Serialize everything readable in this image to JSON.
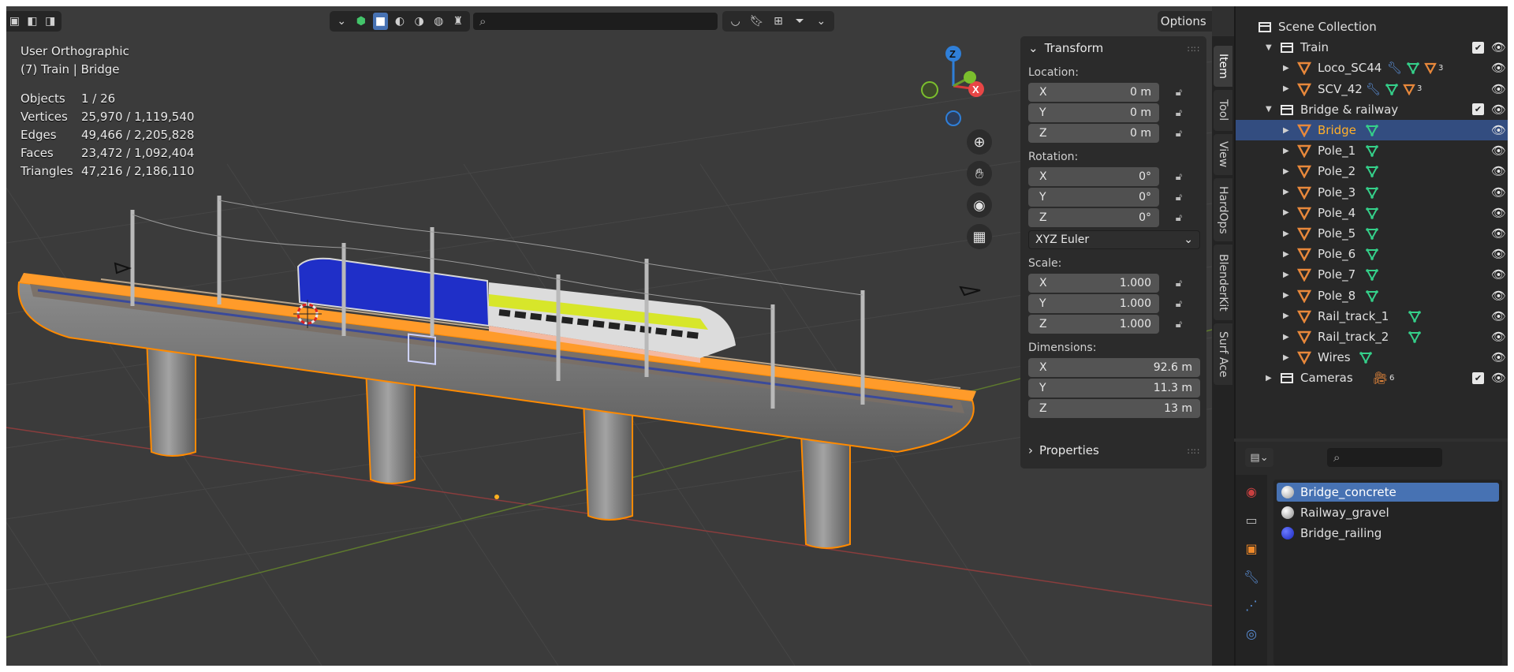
{
  "viewport": {
    "view_name": "User Orthographic",
    "active_object": "(7) Train | Bridge",
    "stats": [
      {
        "label": "Objects",
        "value": "1 / 26"
      },
      {
        "label": "Vertices",
        "value": "25,970 / 1,119,540"
      },
      {
        "label": "Edges",
        "value": "49,466 / 2,205,828"
      },
      {
        "label": "Faces",
        "value": "23,472 / 1,092,404"
      },
      {
        "label": "Triangles",
        "value": "47,216 / 2,186,110"
      }
    ],
    "options_label": "Options",
    "gizmo": {
      "z": "Z",
      "x": "X"
    }
  },
  "npanel": {
    "transform_title": "Transform",
    "location_label": "Location:",
    "location": [
      {
        "axis": "X",
        "value": "0 m"
      },
      {
        "axis": "Y",
        "value": "0 m"
      },
      {
        "axis": "Z",
        "value": "0 m"
      }
    ],
    "rotation_label": "Rotation:",
    "rotation": [
      {
        "axis": "X",
        "value": "0°"
      },
      {
        "axis": "Y",
        "value": "0°"
      },
      {
        "axis": "Z",
        "value": "0°"
      }
    ],
    "rotation_mode": "XYZ Euler",
    "scale_label": "Scale:",
    "scale": [
      {
        "axis": "X",
        "value": "1.000"
      },
      {
        "axis": "Y",
        "value": "1.000"
      },
      {
        "axis": "Z",
        "value": "1.000"
      }
    ],
    "dimensions_label": "Dimensions:",
    "dimensions": [
      {
        "axis": "X",
        "value": "92.6 m"
      },
      {
        "axis": "Y",
        "value": "11.3 m"
      },
      {
        "axis": "Z",
        "value": "13 m"
      }
    ],
    "properties_title": "Properties",
    "tabs": [
      "Item",
      "Tool",
      "View",
      "HardOps",
      "BlenderKit",
      "Surf Ace"
    ]
  },
  "outliner": {
    "rows": [
      {
        "label": "Scene Collection",
        "kind": "scene",
        "depth": 0
      },
      {
        "label": "Train",
        "kind": "collection",
        "depth": 1,
        "open": true
      },
      {
        "label": "Loco_SC44",
        "kind": "mesh",
        "depth": 2,
        "extras": "mods3"
      },
      {
        "label": "SCV_42",
        "kind": "mesh",
        "depth": 2,
        "extras": "mods3"
      },
      {
        "label": "Bridge & railway",
        "kind": "collection",
        "depth": 1,
        "open": true
      },
      {
        "label": "Bridge",
        "kind": "mesh",
        "depth": 2,
        "selected": true
      },
      {
        "label": "Pole_1",
        "kind": "mesh",
        "depth": 2
      },
      {
        "label": "Pole_2",
        "kind": "mesh",
        "depth": 2
      },
      {
        "label": "Pole_3",
        "kind": "mesh",
        "depth": 2
      },
      {
        "label": "Pole_4",
        "kind": "mesh",
        "depth": 2
      },
      {
        "label": "Pole_5",
        "kind": "mesh",
        "depth": 2
      },
      {
        "label": "Pole_6",
        "kind": "mesh",
        "depth": 2
      },
      {
        "label": "Pole_7",
        "kind": "mesh",
        "depth": 2
      },
      {
        "label": "Pole_8",
        "kind": "mesh",
        "depth": 2
      },
      {
        "label": "Rail_track_1",
        "kind": "mesh",
        "depth": 2
      },
      {
        "label": "Rail_track_2",
        "kind": "mesh",
        "depth": 2
      },
      {
        "label": "Wires",
        "kind": "mesh",
        "depth": 2
      },
      {
        "label": "Cameras",
        "kind": "collection",
        "depth": 1,
        "open": false,
        "extras": "cam6"
      }
    ],
    "mod_count": "3",
    "camera_count": "6"
  },
  "properties": {
    "materials": [
      {
        "label": "Bridge_concrete",
        "color": "#e0e0e0",
        "selected": true
      },
      {
        "label": "Railway_gravel",
        "color": "#d8d8d8"
      },
      {
        "label": "Bridge_railing",
        "color": "#2b3ad0"
      }
    ]
  },
  "colors": {
    "accent": "#4772b3",
    "selection": "#ff8a00",
    "active_text": "#ffaf29",
    "mesh_orange": "#e8883b"
  }
}
